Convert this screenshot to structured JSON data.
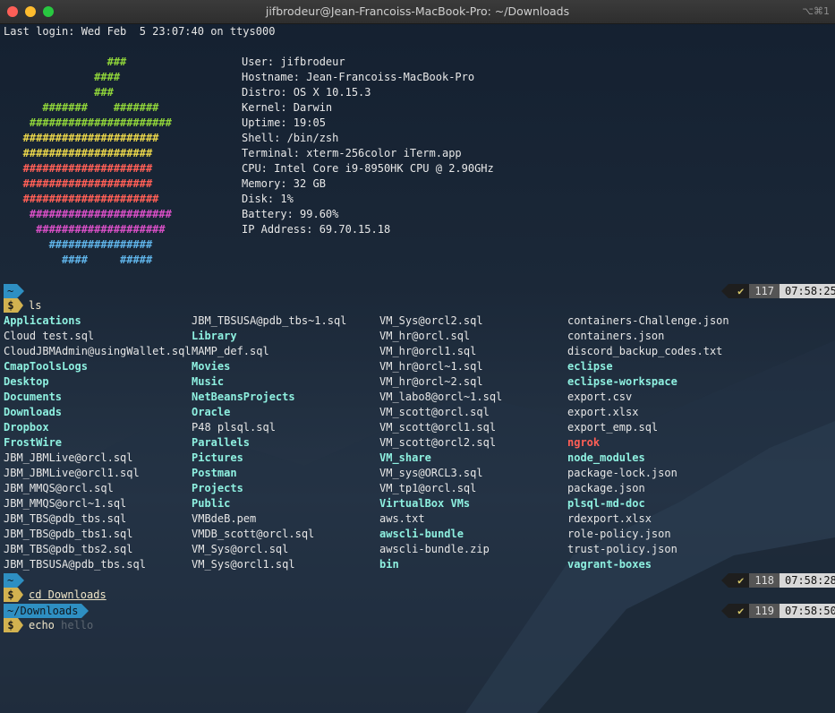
{
  "window": {
    "title": "jifbrodeur@Jean-Francoiss-MacBook-Pro: ~/Downloads",
    "shortcut": "⌥⌘1"
  },
  "terminal": {
    "last_login": "Last login: Wed Feb  5 23:07:40 on ttys000",
    "neofetch_art": [
      {
        "text": "                ###",
        "color": "#8fd43a"
      },
      {
        "text": "              ####",
        "color": "#8fd43a"
      },
      {
        "text": "              ###",
        "color": "#8fd43a"
      },
      {
        "text": "      #######    #######",
        "color": "#8fd43a"
      },
      {
        "text": "    ######################",
        "color": "#8fd43a"
      },
      {
        "text": "   #####################",
        "color": "#e8d44a"
      },
      {
        "text": "   ####################",
        "color": "#e8d44a"
      },
      {
        "text": "   ####################",
        "color": "#ff5f56"
      },
      {
        "text": "   ####################",
        "color": "#ff5f56"
      },
      {
        "text": "   #####################",
        "color": "#ff5f56"
      },
      {
        "text": "    ######################",
        "color": "#d84fc6"
      },
      {
        "text": "     ####################",
        "color": "#d84fc6"
      },
      {
        "text": "       ################",
        "color": "#5fb3e8"
      },
      {
        "text": "         ####     #####",
        "color": "#5fb3e8"
      }
    ],
    "sysinfo": [
      "User: jifbrodeur",
      "Hostname: Jean-Francoiss-MacBook-Pro",
      "Distro: OS X 10.15.3",
      "Kernel: Darwin",
      "Uptime: 19:05",
      "Shell: /bin/zsh",
      "Terminal: xterm-256color iTerm.app",
      "CPU: Intel Core i9-8950HK CPU @ 2.90GHz",
      "Memory: 32 GB",
      "Disk: 1%",
      "Battery: 99.60%",
      "IP Address: 69.70.15.18"
    ],
    "prompts": [
      {
        "path": "~",
        "command": "ls",
        "ghost": "",
        "status_check": "✔",
        "status_num": "117",
        "status_time": "07:58:25"
      },
      {
        "path": "~",
        "command": "cd Downloads",
        "ghost": "",
        "status_check": "✔",
        "status_num": "118",
        "status_time": "07:58:28"
      },
      {
        "path": "~/Downloads",
        "command": "echo ",
        "ghost": "hello",
        "status_check": "✔",
        "status_num": "119",
        "status_time": "07:58:50"
      }
    ],
    "dollar": "$",
    "ls_columns": [
      [
        {
          "name": "Applications",
          "kind": "dir"
        },
        {
          "name": "Cloud test.sql",
          "kind": "file"
        },
        {
          "name": "CloudJBMAdmin@usingWallet.sql",
          "kind": "file"
        },
        {
          "name": "CmapToolsLogs",
          "kind": "dir"
        },
        {
          "name": "Desktop",
          "kind": "dir"
        },
        {
          "name": "Documents",
          "kind": "dir"
        },
        {
          "name": "Downloads",
          "kind": "dir"
        },
        {
          "name": "Dropbox",
          "kind": "dir"
        },
        {
          "name": "FrostWire",
          "kind": "dir"
        },
        {
          "name": "JBM_JBMLive@orcl.sql",
          "kind": "file"
        },
        {
          "name": "JBM_JBMLive@orcl1.sql",
          "kind": "file"
        },
        {
          "name": "JBM_MMQS@orcl.sql",
          "kind": "file"
        },
        {
          "name": "JBM_MMQS@orcl~1.sql",
          "kind": "file"
        },
        {
          "name": "JBM_TBS@pdb_tbs.sql",
          "kind": "file"
        },
        {
          "name": "JBM_TBS@pdb_tbs1.sql",
          "kind": "file"
        },
        {
          "name": "JBM_TBS@pdb_tbs2.sql",
          "kind": "file"
        },
        {
          "name": "JBM_TBSUSA@pdb_tbs.sql",
          "kind": "file"
        }
      ],
      [
        {
          "name": "JBM_TBSUSA@pdb_tbs~1.sql",
          "kind": "file"
        },
        {
          "name": "Library",
          "kind": "dir"
        },
        {
          "name": "MAMP_def.sql",
          "kind": "file"
        },
        {
          "name": "Movies",
          "kind": "dir"
        },
        {
          "name": "Music",
          "kind": "dir"
        },
        {
          "name": "NetBeansProjects",
          "kind": "dir"
        },
        {
          "name": "Oracle",
          "kind": "dir"
        },
        {
          "name": "P48 plsql.sql",
          "kind": "file"
        },
        {
          "name": "Parallels",
          "kind": "dir"
        },
        {
          "name": "Pictures",
          "kind": "dir"
        },
        {
          "name": "Postman",
          "kind": "dir"
        },
        {
          "name": "Projects",
          "kind": "dir"
        },
        {
          "name": "Public",
          "kind": "dir"
        },
        {
          "name": "VMBdeB.pem",
          "kind": "file"
        },
        {
          "name": "VMDB_scott@orcl.sql",
          "kind": "file"
        },
        {
          "name": "VM_Sys@orcl.sql",
          "kind": "file"
        },
        {
          "name": "VM_Sys@orcl1.sql",
          "kind": "file"
        }
      ],
      [
        {
          "name": "VM_Sys@orcl2.sql",
          "kind": "file"
        },
        {
          "name": "VM_hr@orcl.sql",
          "kind": "file"
        },
        {
          "name": "VM_hr@orcl1.sql",
          "kind": "file"
        },
        {
          "name": "VM_hr@orcl~1.sql",
          "kind": "file"
        },
        {
          "name": "VM_hr@orcl~2.sql",
          "kind": "file"
        },
        {
          "name": "VM_labo8@orcl~1.sql",
          "kind": "file"
        },
        {
          "name": "VM_scott@orcl.sql",
          "kind": "file"
        },
        {
          "name": "VM_scott@orcl1.sql",
          "kind": "file"
        },
        {
          "name": "VM_scott@orcl2.sql",
          "kind": "file"
        },
        {
          "name": "VM_share",
          "kind": "dir"
        },
        {
          "name": "VM_sys@ORCL3.sql",
          "kind": "file"
        },
        {
          "name": "VM_tp1@orcl.sql",
          "kind": "file"
        },
        {
          "name": "VirtualBox VMs",
          "kind": "dir"
        },
        {
          "name": "aws.txt",
          "kind": "file"
        },
        {
          "name": "awscli-bundle",
          "kind": "dir"
        },
        {
          "name": "awscli-bundle.zip",
          "kind": "file"
        },
        {
          "name": "bin",
          "kind": "dir"
        }
      ],
      [
        {
          "name": "containers-Challenge.json",
          "kind": "file"
        },
        {
          "name": "containers.json",
          "kind": "file"
        },
        {
          "name": "discord_backup_codes.txt",
          "kind": "file"
        },
        {
          "name": "eclipse",
          "kind": "dir"
        },
        {
          "name": "eclipse-workspace",
          "kind": "dir"
        },
        {
          "name": "export.csv",
          "kind": "file"
        },
        {
          "name": "export.xlsx",
          "kind": "file"
        },
        {
          "name": "export_emp.sql",
          "kind": "file"
        },
        {
          "name": "ngrok",
          "kind": "red"
        },
        {
          "name": "node_modules",
          "kind": "dir"
        },
        {
          "name": "package-lock.json",
          "kind": "file"
        },
        {
          "name": "package.json",
          "kind": "file"
        },
        {
          "name": "plsql-md-doc",
          "kind": "dir"
        },
        {
          "name": "rdexport.xlsx",
          "kind": "file"
        },
        {
          "name": "role-policy.json",
          "kind": "file"
        },
        {
          "name": "trust-policy.json",
          "kind": "file"
        },
        {
          "name": "vagrant-boxes",
          "kind": "dir"
        }
      ]
    ]
  }
}
